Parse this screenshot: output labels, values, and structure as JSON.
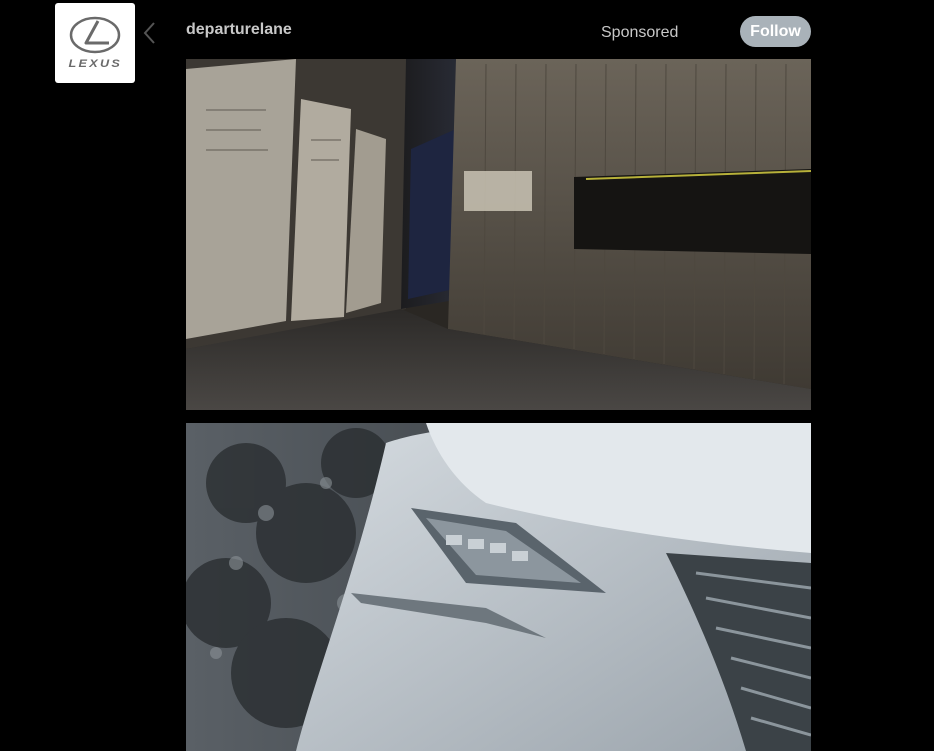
{
  "post": {
    "avatar": {
      "brand_text": "LEXUS",
      "icon": "lexus-logo"
    },
    "username": "departurelane",
    "sponsored_label": "Sponsored",
    "follow_label": "Follow",
    "back_icon": "chevron-left-icon"
  },
  "media": [
    {
      "icon": "photo-gallery-interior"
    },
    {
      "icon": "photo-car-front-grille"
    }
  ],
  "colors": {
    "background": "#000000",
    "text": "#c8c8c8",
    "follow_button": "#a9b2b9",
    "follow_text": "#ffffff"
  }
}
